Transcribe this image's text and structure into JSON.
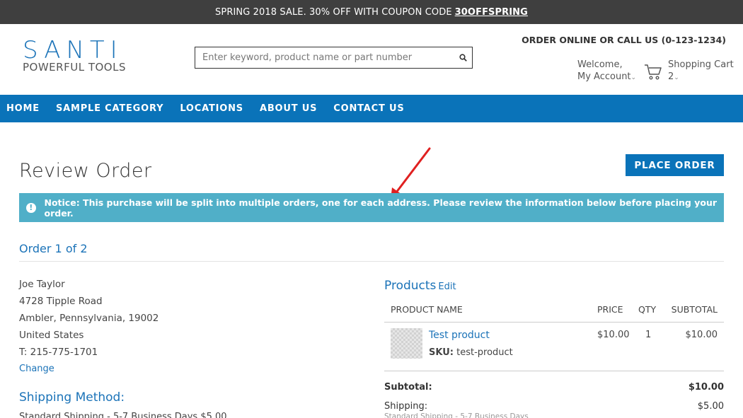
{
  "promo": {
    "text": "SPRING 2018 SALE. 30% OFF WITH COUPON CODE",
    "code": "30OFFSPRING"
  },
  "logo": {
    "main": "SANTI",
    "sub": "POWERFUL TOOLS"
  },
  "search": {
    "placeholder": "Enter keyword, product name or part number"
  },
  "header": {
    "call_us": "ORDER ONLINE OR CALL US (0-123-1234)",
    "welcome": "Welcome,",
    "my_account": "My Account",
    "cart_label": "Shopping Cart",
    "cart_count": "2"
  },
  "nav": {
    "items": [
      "HOME",
      "SAMPLE CATEGORY",
      "LOCATIONS",
      "ABOUT US",
      "CONTACT US"
    ]
  },
  "page": {
    "title": "Review Order",
    "place_order": "PLACE ORDER"
  },
  "notice": {
    "text": "Notice: This purchase will be split into multiple orders, one for each address. Please review the information below before placing your order."
  },
  "order": {
    "heading": "Order 1 of 2",
    "address": {
      "name": "Joe Taylor",
      "street": "4728 Tipple Road",
      "city_state_zip": "Ambler, Pennsylvania, 19002",
      "country": "United States",
      "phone": "T: 215-775-1701"
    },
    "change_label": "Change",
    "shipping_heading": "Shipping Method:",
    "shipping_method": "Standard Shipping - 5-7 Business Days $5.00"
  },
  "products": {
    "heading": "Products",
    "edit_label": "Edit",
    "columns": {
      "name": "PRODUCT NAME",
      "price": "PRICE",
      "qty": "QTY",
      "subtotal": "SUBTOTAL"
    },
    "rows": [
      {
        "name": "Test product",
        "sku_label": "SKU:",
        "sku": "test-product",
        "price": "$10.00",
        "qty": "1",
        "subtotal": "$10.00"
      }
    ]
  },
  "summary": {
    "subtotal_label": "Subtotal:",
    "subtotal_value": "$10.00",
    "shipping_label": "Shipping:",
    "shipping_value": "$5.00",
    "shipping_note": "Standard Shipping - 5-7 Business Days"
  },
  "colors": {
    "brand_blue": "#0a73b9",
    "notice_bg": "#50afc8",
    "promo_bg": "#3f3f3f",
    "annotation_arrow": "#e02020"
  }
}
